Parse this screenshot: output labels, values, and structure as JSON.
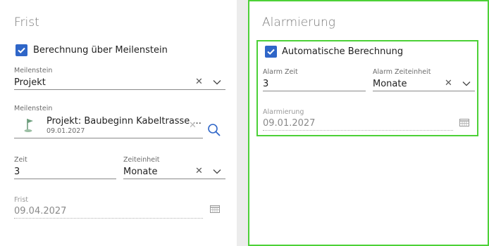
{
  "frist": {
    "title": "Frist",
    "checkbox_label": "Berechnung über Meilenstein",
    "meilenstein_select": {
      "label": "Meilenstein",
      "value": "Projekt"
    },
    "meilenstein_lookup": {
      "label": "Meilenstein",
      "name": "Projekt: Baubeginn Kabeltrasse ...",
      "date": "09.01.2027"
    },
    "zeit": {
      "label": "Zeit",
      "value": "3"
    },
    "zeiteinheit": {
      "label": "Zeiteinheit",
      "value": "Monate"
    },
    "frist_date": {
      "label": "Frist",
      "value": "09.04.2027"
    }
  },
  "alarmierung": {
    "title": "Alarmierung",
    "checkbox_label": "Automatische Berechnung",
    "alarm_zeit": {
      "label": "Alarm Zeit",
      "value": "3"
    },
    "alarm_zeiteinheit": {
      "label": "Alarm Zeiteinheit",
      "value": "Monate"
    },
    "alarmierung_date": {
      "label": "Alarmierung",
      "value": "09.01.2027"
    }
  },
  "colors": {
    "accent": "#2f66c8",
    "highlight": "#4cd137",
    "background": "#ececec"
  },
  "icons": [
    "checkbox-check-icon",
    "clear-icon",
    "chevron-down-icon",
    "flag-icon",
    "search-icon",
    "calendar-icon"
  ]
}
